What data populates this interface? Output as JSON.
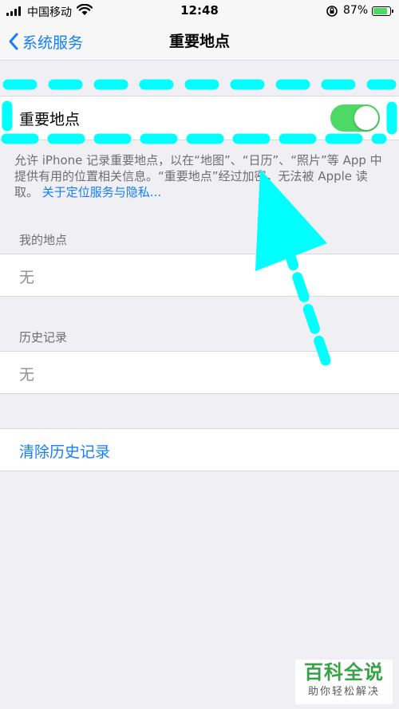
{
  "status_bar": {
    "carrier": "中国移动",
    "time": "12:48",
    "battery_percent": "87%",
    "battery_level": 0.87,
    "icons": [
      "signal-icon",
      "wifi-icon",
      "rotation-lock-icon",
      "battery-icon"
    ]
  },
  "nav": {
    "back_label": "系统服务",
    "title": "重要地点"
  },
  "toggle_row": {
    "label": "重要地点",
    "enabled": true
  },
  "footer_note": {
    "text": "允许 iPhone 记录重要地点，以在“地图”、“日历”、“照片”等 App 中提供有用的位置相关信息。“重要地点”经过加密，无法被 Apple 读取。",
    "link": "关于定位服务与隐私..."
  },
  "my_places": {
    "header": "我的地点",
    "value": "无"
  },
  "history": {
    "header": "历史记录",
    "value": "无"
  },
  "clear_history": {
    "label": "清除历史记录"
  },
  "watermark": {
    "title": "百科全说",
    "subtitle": "助你轻松解决"
  },
  "colors": {
    "accent": "#157efb",
    "toggle_on": "#4cd964",
    "annotation": "#00ffff",
    "background": "#efeff4"
  }
}
